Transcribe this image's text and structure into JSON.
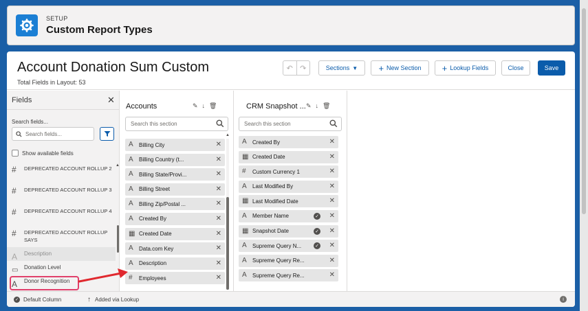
{
  "setup": {
    "kicker": "SETUP",
    "title": "Custom Report Types",
    "icon": "gear-icon"
  },
  "page": {
    "title": "Account Donation Sum Custom",
    "total_fields": "Total Fields in Layout: 53"
  },
  "toolbar": {
    "sections_label": "Sections",
    "new_section_label": "New Section",
    "lookup_fields_label": "Lookup Fields",
    "close_label": "Close",
    "save_label": "Save"
  },
  "fields_panel": {
    "title": "Fields",
    "search_label": "Search fields...",
    "search_placeholder": "Search fields...",
    "show_available": "Show available fields",
    "items": [
      {
        "icon": "#",
        "label": "DEPRECATED ACCOUNT ROLLUP 2"
      },
      {
        "icon": "#",
        "label": "DEPRECATED ACCOUNT ROLLUP 3"
      },
      {
        "icon": "#",
        "label": "DEPRECATED ACCOUNT ROLLUP 4"
      },
      {
        "icon": "#",
        "label": "DEPRECATED ACCOUNT ROLLUP Says"
      },
      {
        "icon": "A",
        "label": "Description"
      },
      {
        "icon": "▭",
        "label": "Donation Level"
      },
      {
        "icon": "A",
        "label": "Donor Recognition"
      }
    ]
  },
  "accounts_section": {
    "title": "Accounts",
    "search_placeholder": "Search this section",
    "items": [
      {
        "icon": "A",
        "label": "Billing City"
      },
      {
        "icon": "A",
        "label": "Billing Country (t..."
      },
      {
        "icon": "A",
        "label": "Billing State/Provi..."
      },
      {
        "icon": "A",
        "label": "Billing Street"
      },
      {
        "icon": "A",
        "label": "Billing Zip/Postal ..."
      },
      {
        "icon": "A",
        "label": "Created By"
      },
      {
        "icon": "▦",
        "label": "Created Date"
      },
      {
        "icon": "A",
        "label": "Data.com Key"
      },
      {
        "icon": "A",
        "label": "Description"
      },
      {
        "icon": "#",
        "label": "Employees"
      }
    ]
  },
  "crm_section": {
    "title": "CRM Snapshot ...",
    "search_placeholder": "Search this section",
    "items": [
      {
        "icon": "A",
        "label": "Created By",
        "default": false
      },
      {
        "icon": "▦",
        "label": "Created Date",
        "default": false
      },
      {
        "icon": "#",
        "label": "Custom Currency 1",
        "default": false
      },
      {
        "icon": "A",
        "label": "Last Modified By",
        "default": false
      },
      {
        "icon": "▦",
        "label": "Last Modified Date",
        "default": false
      },
      {
        "icon": "A",
        "label": "Member Name",
        "default": true
      },
      {
        "icon": "▦",
        "label": "Snapshot Date",
        "default": true
      },
      {
        "icon": "A",
        "label": "Supreme Query N...",
        "default": true
      },
      {
        "icon": "A",
        "label": "Supreme Query Re...",
        "default": false
      },
      {
        "icon": "A",
        "label": "Supreme Query Re...",
        "default": false
      }
    ]
  },
  "footer": {
    "default_column": "Default Column",
    "added_via_lookup": "Added via Lookup"
  },
  "colors": {
    "brand_blue": "#0b5cab",
    "frame_blue": "#1b5fa6",
    "highlight": "#e0406b"
  }
}
